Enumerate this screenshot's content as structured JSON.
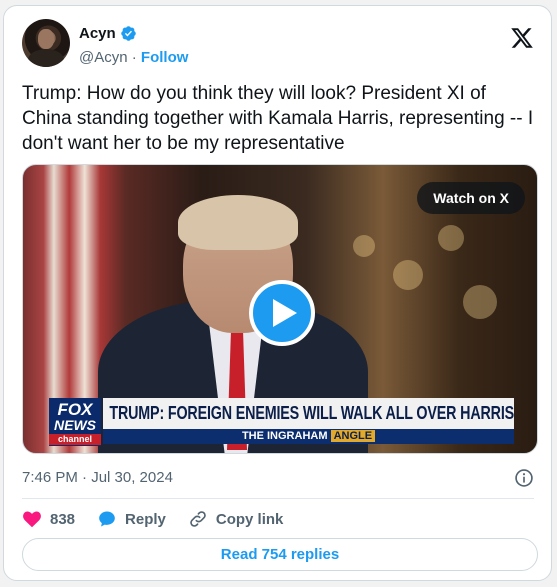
{
  "author": {
    "display_name": "Acyn",
    "handle": "@Acyn",
    "separator": "·",
    "follow_label": "Follow"
  },
  "tweet": {
    "text": "Trump: How do you think they will look? President XI of China standing together with Kamala Harris, representing -- I don't want her to be my representative"
  },
  "media": {
    "watch_label": "Watch on X",
    "chyron": {
      "network_line1": "FOX",
      "network_line2": "NEWS",
      "network_line3": "channel",
      "headline": "TRUMP: FOREIGN ENEMIES WILL WALK ALL OVER HARRIS",
      "show_prefix": "THE INGRAHAM",
      "show_suffix": "ANGLE"
    }
  },
  "meta": {
    "timestamp": "7:46 PM · Jul 30, 2024"
  },
  "actions": {
    "like_count": "838",
    "reply_label": "Reply",
    "copy_label": "Copy link"
  },
  "footer": {
    "read_replies_label": "Read 754 replies"
  },
  "colors": {
    "accent": "#1d9bf0",
    "like": "#f91880",
    "text_primary": "#0f1419",
    "text_secondary": "#536471"
  },
  "icons": [
    "verified-badge-icon",
    "x-logo-icon",
    "play-icon",
    "info-icon",
    "heart-icon",
    "reply-bubble-icon",
    "link-icon"
  ]
}
